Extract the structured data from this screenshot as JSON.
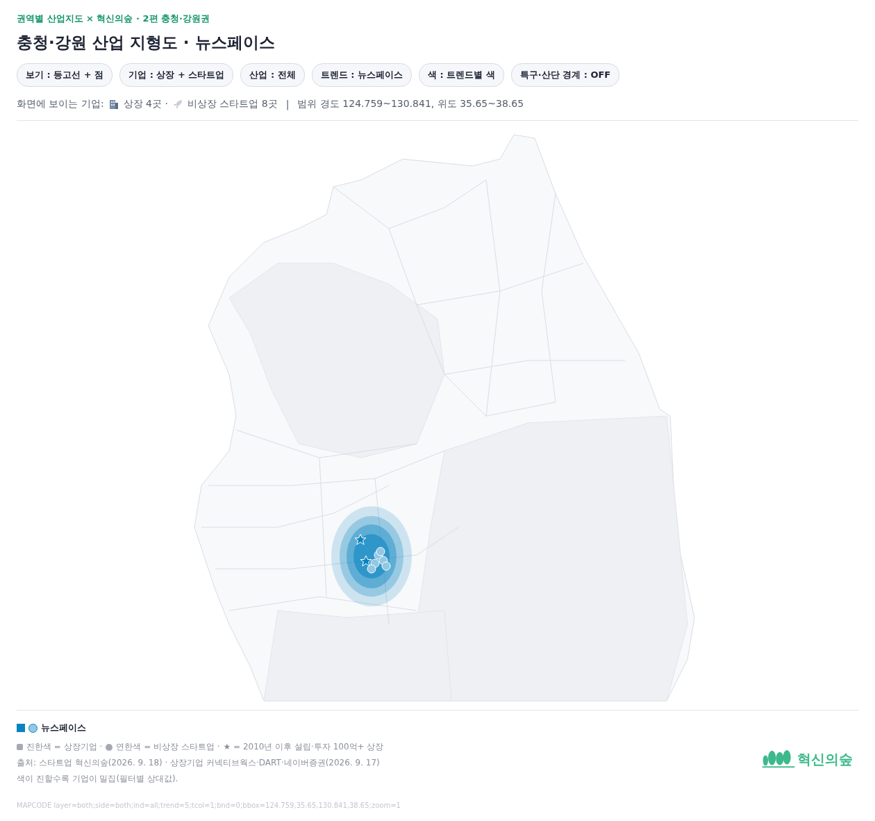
{
  "header": {
    "kicker": "권역별 산업지도 × 혁신의숲 · 2편 충청·강원권",
    "title": "충청·강원 산업 지형도 · 뉴스페이스"
  },
  "filters": [
    {
      "label": "보기 : 등고선 + 점"
    },
    {
      "label": "기업 : 상장 + 스타트업"
    },
    {
      "label": "산업 : 전체"
    },
    {
      "label": "트렌드 : 뉴스페이스"
    },
    {
      "label": "색 : 트렌드별 색"
    },
    {
      "label": "특구·산단 경계 : OFF"
    }
  ],
  "summary": {
    "label": "화면에 보이는 기업:",
    "listed": "상장 4곳 ·",
    "startups": "비상장 스타트업 8곳",
    "separator": "|",
    "range": "범위 경도 124.759~130.841, 위도 35.65~38.65"
  },
  "legend": {
    "items": [
      {
        "name": "뉴스페이스",
        "color": "#0a84c1"
      }
    ],
    "key": [
      {
        "kind": "square",
        "text": "진한색 = 상장기업 ·"
      },
      {
        "kind": "circle",
        "text": "연한색 = 비상장 스타트업 ·"
      },
      {
        "kind": "plain",
        "text": "★ = 2010년 이후 설립·투자 100억+ 상장"
      }
    ],
    "notes": [
      "출처: 스타트업 혁신의숲(2026. 9. 18) · 상장기업 커넥티브웍스·DART·네이버증권(2026. 9. 17)",
      "색이 진할수록 기업이 밀집(필터별 상대값)."
    ],
    "mapcode": "MAPCODE layer=both;side=both;ind=all;trend=5;tcol=1;bnd=0;bbox=124.759,35.65,130.841,38.65;zoom=1"
  },
  "logo": {
    "text": "혁신의숲"
  }
}
